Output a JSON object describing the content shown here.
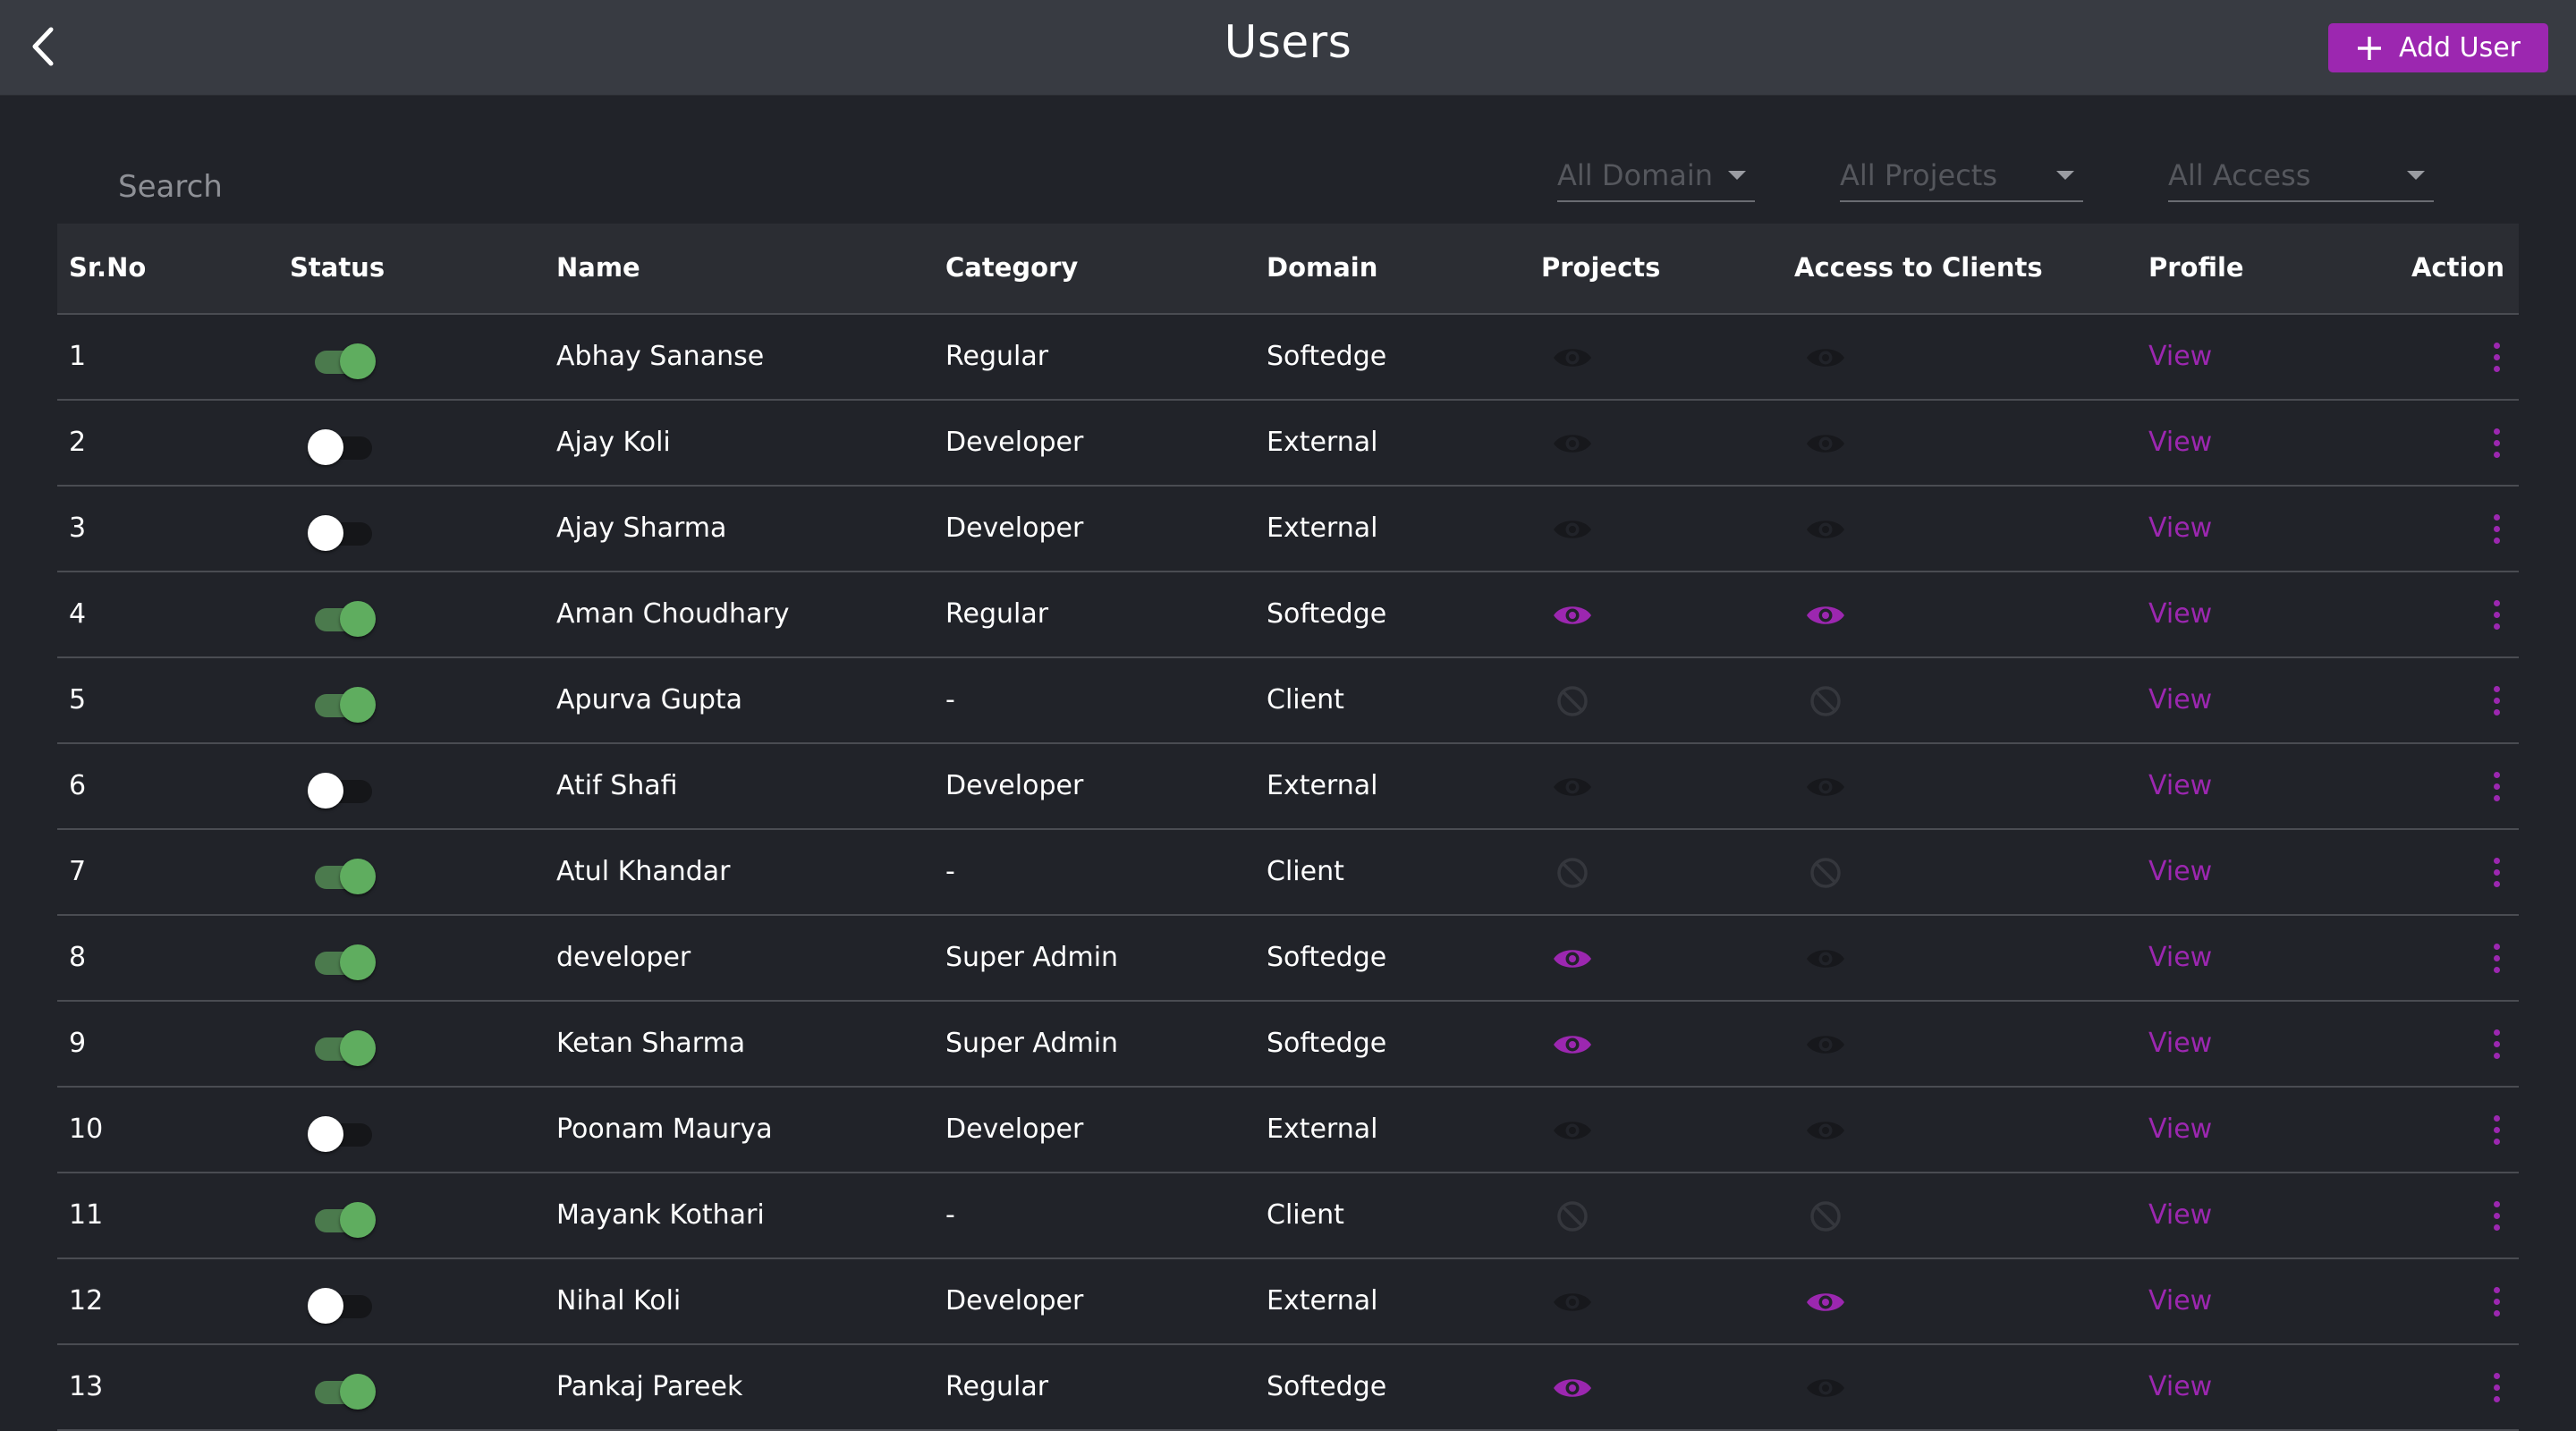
{
  "header": {
    "title": "Users",
    "add_button_label": "Add User"
  },
  "filters": {
    "search_placeholder": "Search",
    "domain_label": "All Domain",
    "projects_label": "All Projects",
    "access_label": "All Access"
  },
  "table": {
    "columns": [
      "Sr.No",
      "Status",
      "Name",
      "Category",
      "Domain",
      "Projects",
      "Access to Clients",
      "Profile",
      "Action"
    ],
    "rows": [
      {
        "srno": "1",
        "status": "on",
        "name": "Abhay Sananse",
        "category": "Regular",
        "domain": "Softedge",
        "projects": "eye-dim",
        "access": "eye-dim",
        "profile": "View"
      },
      {
        "srno": "2",
        "status": "off",
        "name": "Ajay Koli",
        "category": "Developer",
        "domain": "External",
        "projects": "eye-dim",
        "access": "eye-dim",
        "profile": "View"
      },
      {
        "srno": "3",
        "status": "off",
        "name": "Ajay Sharma",
        "category": "Developer",
        "domain": "External",
        "projects": "eye-dim",
        "access": "eye-dim",
        "profile": "View"
      },
      {
        "srno": "4",
        "status": "on",
        "name": "Aman Choudhary",
        "category": "Regular",
        "domain": "Softedge",
        "projects": "eye-active",
        "access": "eye-active",
        "profile": "View"
      },
      {
        "srno": "5",
        "status": "on",
        "name": "Apurva Gupta",
        "category": "-",
        "domain": "Client",
        "projects": "block",
        "access": "block",
        "profile": "View"
      },
      {
        "srno": "6",
        "status": "off",
        "name": "Atif Shafi",
        "category": "Developer",
        "domain": "External",
        "projects": "eye-dim",
        "access": "eye-dim",
        "profile": "View"
      },
      {
        "srno": "7",
        "status": "on",
        "name": "Atul Khandar",
        "category": "-",
        "domain": "Client",
        "projects": "block",
        "access": "block",
        "profile": "View"
      },
      {
        "srno": "8",
        "status": "on",
        "name": "developer",
        "category": "Super Admin",
        "domain": "Softedge",
        "projects": "eye-active",
        "access": "eye-dim",
        "profile": "View"
      },
      {
        "srno": "9",
        "status": "on",
        "name": "Ketan Sharma",
        "category": "Super Admin",
        "domain": "Softedge",
        "projects": "eye-active",
        "access": "eye-dim",
        "profile": "View"
      },
      {
        "srno": "10",
        "status": "off",
        "name": "Poonam Maurya",
        "category": "Developer",
        "domain": "External",
        "projects": "eye-dim",
        "access": "eye-dim",
        "profile": "View"
      },
      {
        "srno": "11",
        "status": "on",
        "name": "Mayank Kothari",
        "category": "-",
        "domain": "Client",
        "projects": "block",
        "access": "block",
        "profile": "View"
      },
      {
        "srno": "12",
        "status": "off",
        "name": "Nihal Koli",
        "category": "Developer",
        "domain": "External",
        "projects": "eye-dim",
        "access": "eye-active",
        "profile": "View"
      },
      {
        "srno": "13",
        "status": "on",
        "name": "Pankaj Pareek",
        "category": "Regular",
        "domain": "Softedge",
        "projects": "eye-active",
        "access": "eye-dim",
        "profile": "View"
      }
    ]
  },
  "colors": {
    "accent": "#9c27b0",
    "toggle_on": "#5fad5f",
    "icon_dim": "#17181c",
    "icon_block": "#35373d"
  }
}
